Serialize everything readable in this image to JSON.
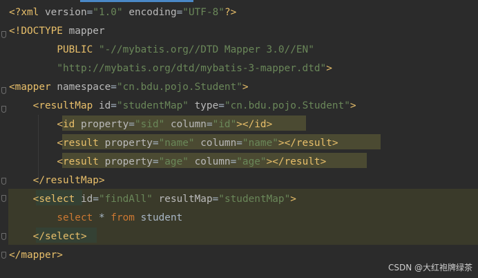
{
  "lines": [
    {
      "t": [
        [
          "pi",
          "<?xml "
        ],
        [
          "attr",
          "version"
        ],
        [
          "plain",
          "="
        ],
        [
          "val",
          "\"1.0\""
        ],
        [
          "plain",
          " "
        ],
        [
          "attr",
          "encoding"
        ],
        [
          "plain",
          "="
        ],
        [
          "val",
          "\"UTF-8\""
        ],
        [
          "pi",
          "?>"
        ]
      ]
    },
    {
      "t": [
        [
          "pi",
          "<!DOCTYPE "
        ],
        [
          "attr",
          "mapper"
        ]
      ]
    },
    {
      "t": [
        [
          "plain",
          "        "
        ],
        [
          "tag",
          "PUBLIC "
        ],
        [
          "val",
          "\"-//mybatis.org//DTD Mapper 3.0//EN\""
        ]
      ]
    },
    {
      "t": [
        [
          "plain",
          "        "
        ],
        [
          "val",
          "\"http://mybatis.org/dtd/mybatis-3-mapper.dtd\""
        ],
        [
          "pi",
          ">"
        ]
      ]
    },
    {
      "t": [
        [
          "tag",
          "<mapper "
        ],
        [
          "attr",
          "namespace"
        ],
        [
          "plain",
          "="
        ],
        [
          "val",
          "\"cn.bdu.pojo.Student\""
        ],
        [
          "tag",
          ">"
        ]
      ]
    },
    {
      "t": [
        [
          "plain",
          "    "
        ],
        [
          "tag",
          "<resultMap "
        ],
        [
          "attr",
          "id"
        ],
        [
          "plain",
          "="
        ],
        [
          "val",
          "\"studentMap\""
        ],
        [
          "plain",
          " "
        ],
        [
          "attr",
          "type"
        ],
        [
          "plain",
          "="
        ],
        [
          "val",
          "\"cn.bdu.pojo.Student\""
        ],
        [
          "tag",
          ">"
        ]
      ]
    },
    {
      "t": [
        [
          "plain",
          "        "
        ],
        [
          "tag",
          "<id "
        ],
        [
          "attr",
          "property"
        ],
        [
          "plain",
          "="
        ],
        [
          "val",
          "\"sid\""
        ],
        [
          "plain",
          " "
        ],
        [
          "attr",
          "column"
        ],
        [
          "plain",
          "="
        ],
        [
          "val",
          "\"id\""
        ],
        [
          "tag",
          "></id>"
        ]
      ]
    },
    {
      "t": [
        [
          "plain",
          "        "
        ],
        [
          "tag",
          "<result "
        ],
        [
          "attr",
          "property"
        ],
        [
          "plain",
          "="
        ],
        [
          "val",
          "\"name\""
        ],
        [
          "plain",
          " "
        ],
        [
          "attr",
          "column"
        ],
        [
          "plain",
          "="
        ],
        [
          "val",
          "\"name\""
        ],
        [
          "tag",
          "></result>"
        ]
      ]
    },
    {
      "t": [
        [
          "plain",
          "        "
        ],
        [
          "tag",
          "<result "
        ],
        [
          "attr",
          "property"
        ],
        [
          "plain",
          "="
        ],
        [
          "val",
          "\"age\""
        ],
        [
          "plain",
          " "
        ],
        [
          "attr",
          "column"
        ],
        [
          "plain",
          "="
        ],
        [
          "val",
          "\"age\""
        ],
        [
          "tag",
          "></result>"
        ]
      ]
    },
    {
      "t": [
        [
          "plain",
          "    "
        ],
        [
          "tag",
          "</resultMap>"
        ]
      ]
    },
    {
      "t": [
        [
          "plain",
          "    "
        ],
        [
          "tag",
          "<select"
        ],
        [
          "plain",
          " "
        ],
        [
          "attr",
          "id"
        ],
        [
          "plain",
          "="
        ],
        [
          "val",
          "\"findAll\""
        ],
        [
          "plain",
          " "
        ],
        [
          "attr",
          "resultMap"
        ],
        [
          "plain",
          "="
        ],
        [
          "val",
          "\"studentMap\""
        ],
        [
          "tag",
          ">"
        ]
      ]
    },
    {
      "t": [
        [
          "plain",
          "        "
        ],
        [
          "kw",
          "select "
        ],
        [
          "plain",
          "* "
        ],
        [
          "kw",
          "from "
        ],
        [
          "plain",
          "student"
        ]
      ]
    },
    {
      "t": [
        [
          "plain",
          "    "
        ],
        [
          "tag",
          "</select>"
        ]
      ]
    },
    {
      "t": [
        [
          "tag",
          "</mapper>"
        ]
      ]
    }
  ],
  "watermark": "CSDN @大红袍牌绿茶"
}
